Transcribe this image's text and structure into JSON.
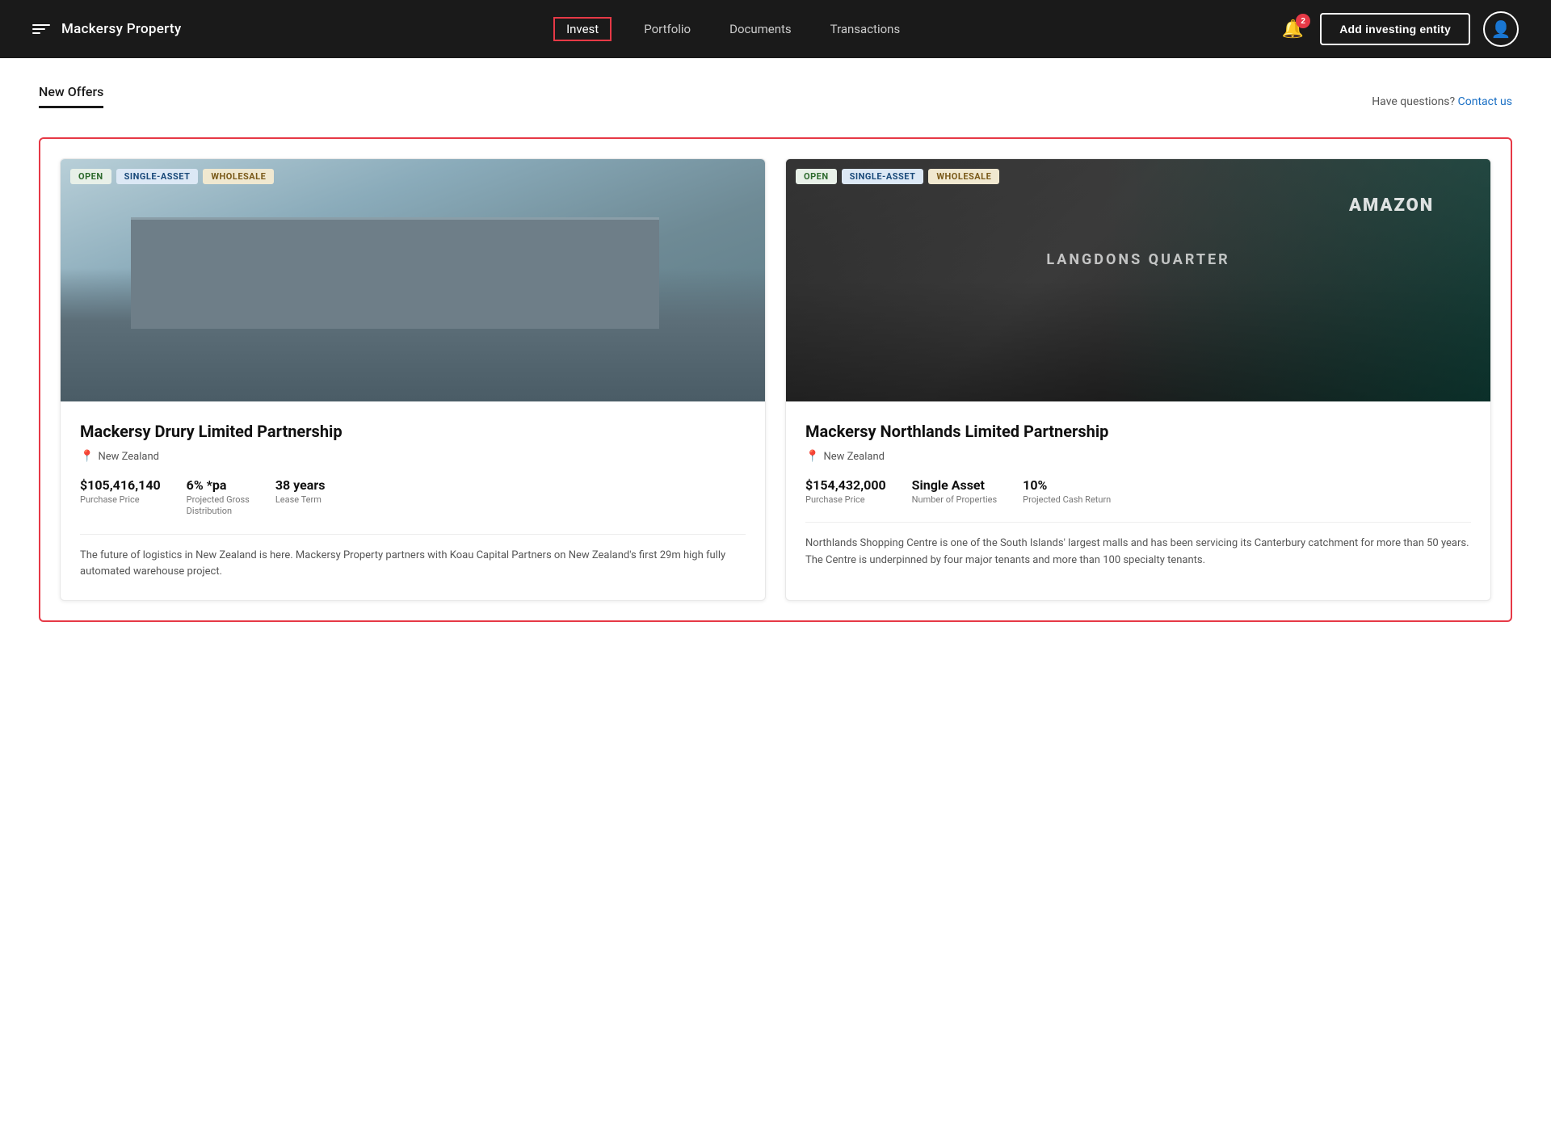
{
  "brand": {
    "name": "Mackersy Property"
  },
  "navbar": {
    "links": [
      {
        "label": "Invest",
        "active": true
      },
      {
        "label": "Portfolio",
        "active": false
      },
      {
        "label": "Documents",
        "active": false
      },
      {
        "label": "Transactions",
        "active": false
      }
    ],
    "notification_count": "2",
    "add_entity_button": "Add investing entity"
  },
  "page": {
    "title": "New Offers",
    "contact_prompt": "Have questions?",
    "contact_link": "Contact us"
  },
  "offers": [
    {
      "id": "drury",
      "title": "Mackersy Drury Limited Partnership",
      "location": "New Zealand",
      "tags": [
        "OPEN",
        "SINGLE-ASSET",
        "WHOLESALE"
      ],
      "stats": [
        {
          "value": "$105,416,140",
          "label": "Purchase Price"
        },
        {
          "value": "6% *pa",
          "label": "Projected Gross\nDistribution"
        },
        {
          "value": "38 years",
          "label": "Lease Term"
        }
      ],
      "description": "The future of logistics in New Zealand is here. Mackersy Property partners with Koau Capital Partners on New Zealand's first 29m high fully automated warehouse project.",
      "image_type": "warehouse"
    },
    {
      "id": "northlands",
      "title": "Mackersy Northlands Limited Partnership",
      "location": "New Zealand",
      "tags": [
        "OPEN",
        "SINGLE-ASSET",
        "WHOLESALE"
      ],
      "stats": [
        {
          "value": "$154,432,000",
          "label": "Purchase Price"
        },
        {
          "value": "Single Asset",
          "label": "Number of Properties"
        },
        {
          "value": "10%",
          "label": "Projected Cash Return"
        }
      ],
      "description": "Northlands Shopping Centre is one of the South Islands' largest malls and has been servicing its Canterbury catchment for more than 50 years. The Centre is underpinned by four major tenants and more than 100 specialty tenants.",
      "image_type": "mall"
    }
  ]
}
